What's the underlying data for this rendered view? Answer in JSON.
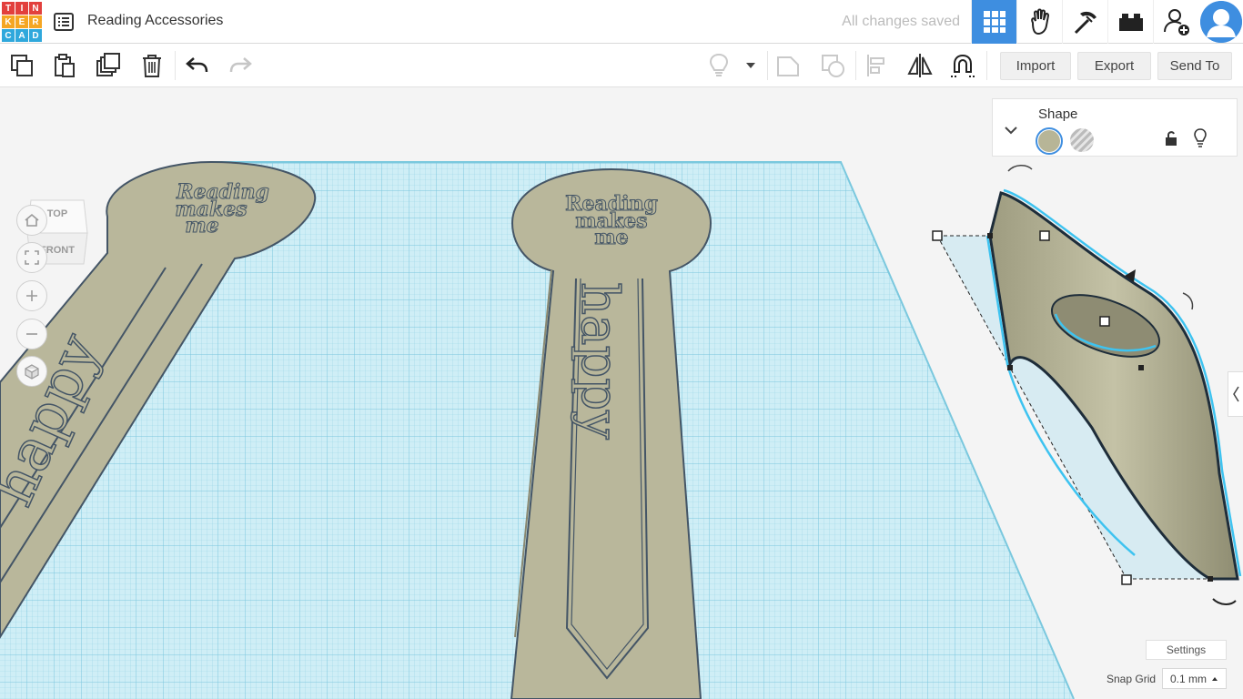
{
  "app": {
    "logo_letters": [
      "T",
      "I",
      "N",
      "K",
      "E",
      "R",
      "C",
      "A",
      "D"
    ],
    "logo_colors": [
      "#e2403d",
      "#e2403d",
      "#e2403d",
      "#f5a623",
      "#f5a623",
      "#f5a623",
      "#2fa8dc",
      "#2fa8dc",
      "#2fa8dc"
    ],
    "doc_title": "Reading Accessories",
    "save_status": "All changes saved",
    "accent": "#3e8ee0"
  },
  "toolbar": {
    "import_label": "Import",
    "export_label": "Export",
    "send_to_label": "Send To"
  },
  "viewcube": {
    "top_label": "TOP",
    "front_label": "FRONT"
  },
  "shape_panel": {
    "title": "Shape",
    "solid_color": "#b7b597",
    "icons": [
      "chevron-down-icon",
      "solid-color-icon",
      "hole-icon",
      "unlock-icon",
      "bulb-icon"
    ]
  },
  "bookmark_text": {
    "line1": "Reading",
    "line2": "makes",
    "line3": "me",
    "word": "happy"
  },
  "bottom": {
    "settings_label": "Settings",
    "snap_label": "Snap Grid",
    "snap_value": "0.1 mm"
  }
}
